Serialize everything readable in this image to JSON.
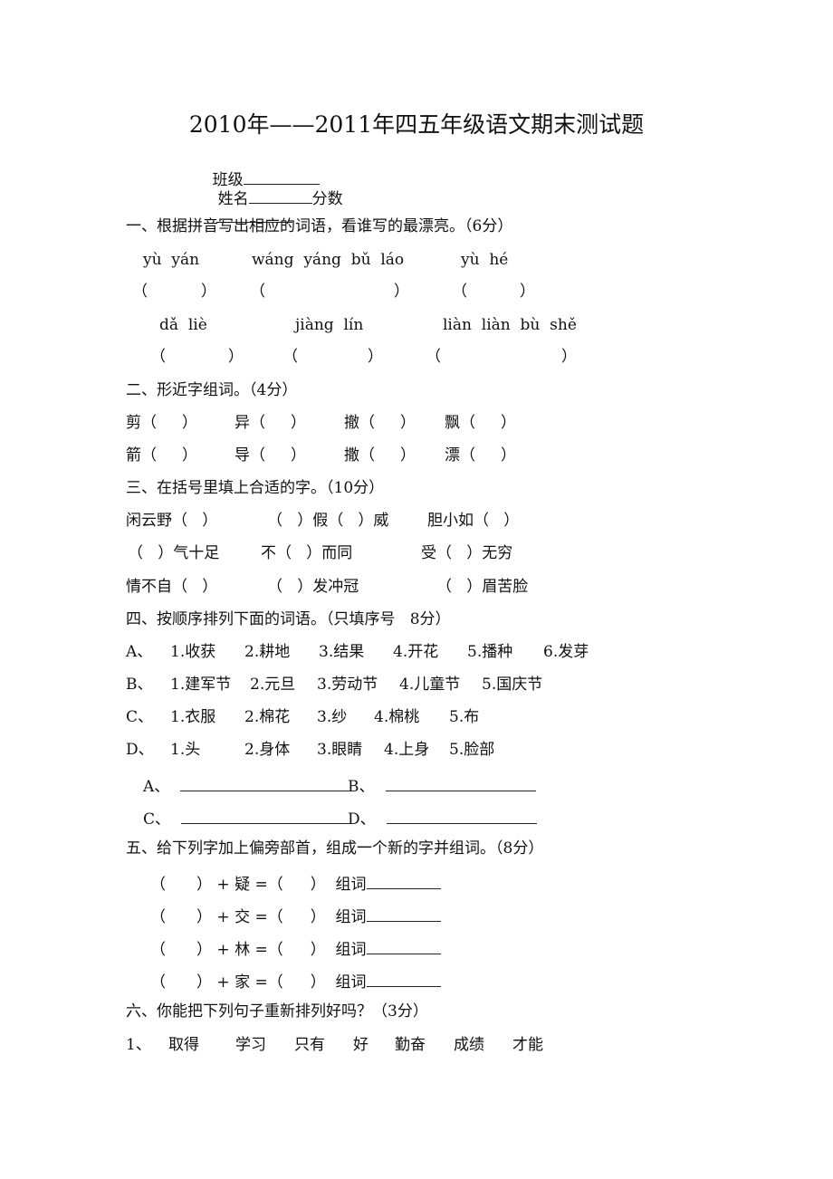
{
  "title": "2010年——2011年四五年级语文期末测试题",
  "header_fields": {
    "class_label": "班级",
    "name_label": "姓名",
    "score_label": "分数"
  },
  "section1": {
    "heading": "一、根据拼音写出相应的词语，看谁写的最漂亮。（6分）",
    "row1_pinyin": [
      "yù  yán",
      "wáng  yáng  bǔ  láo",
      "yù  hé"
    ],
    "row2_pinyin": [
      "dǎ  liè",
      "jiàng  lín",
      "liàn  liàn  bù  shě"
    ],
    "open_paren": "（",
    "close_paren": "）"
  },
  "section2": {
    "heading": "二、形近字组词。（4分）",
    "row1": [
      "剪",
      "异",
      "撤",
      "飘"
    ],
    "row2": [
      "箭",
      "导",
      "撒",
      "漂"
    ],
    "open_paren": "（",
    "close_paren": "）"
  },
  "section3": {
    "heading": "三、在括号里填上合适的字。（10分）",
    "rows": [
      [
        "闲云野（   ）",
        "（   ）假（   ）威",
        "胆小如（   ）"
      ],
      [
        "（   ）气十足",
        "不（   ）而同",
        "受（   ）无穷"
      ],
      [
        "情不自（   ）",
        "（   ）发冲冠",
        "（   ）眉苦脸"
      ]
    ]
  },
  "section4": {
    "heading": "四、按顺序排列下面的词语。（只填序号   8分）",
    "groups": [
      {
        "label": "A、",
        "items": [
          "1.收获",
          "2.耕地",
          "3.结果",
          "4.开花",
          "5.播种",
          "6.发芽"
        ]
      },
      {
        "label": "B、",
        "items": [
          "1.建军节",
          "2.元旦",
          "3.劳动节",
          "4.儿童节",
          "5.国庆节"
        ]
      },
      {
        "label": "C、",
        "items": [
          "1.衣服",
          "2.棉花",
          "3.纱",
          "4.棉桃",
          "5.布"
        ]
      },
      {
        "label": "D、",
        "items": [
          "1.头",
          "2.身体",
          "3.眼睛",
          "4.上身",
          "5.脸部"
        ]
      }
    ],
    "answer_labels": [
      "A、",
      "B、",
      "C、",
      "D、"
    ]
  },
  "section5": {
    "heading": "五、给下列字加上偏旁部首，组成一个新的字并组词。（8分）",
    "chars": [
      "疑",
      "交",
      "林",
      "家"
    ],
    "plus": "+",
    "equals": "=",
    "word_label": "组词",
    "open_paren": "（",
    "close_paren": "）"
  },
  "section6": {
    "heading": "六、你能把下列句子重新排列好吗？（3分）",
    "q1_label": "1、",
    "q1_words": [
      "取得",
      "学习",
      "只有",
      "好",
      "勤奋",
      "成绩",
      "才能"
    ]
  }
}
